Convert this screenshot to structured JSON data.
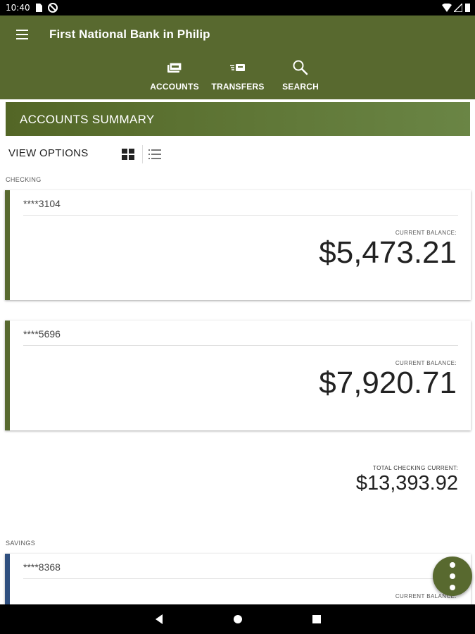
{
  "status_bar": {
    "time": "10:40"
  },
  "app": {
    "title": "First National Bank in Philip",
    "nav": [
      {
        "label": "ACCOUNTS",
        "icon": "accounts-icon"
      },
      {
        "label": "TRANSFERS",
        "icon": "transfers-icon"
      },
      {
        "label": "SEARCH",
        "icon": "search-icon"
      }
    ]
  },
  "summary": {
    "title": "ACCOUNTS SUMMARY"
  },
  "view_options": {
    "label": "VIEW OPTIONS",
    "selected": "grid"
  },
  "checking": {
    "section_label": "CHECKING",
    "accounts": [
      {
        "number": "****3104",
        "balance_label": "CURRENT BALANCE:",
        "balance": "$5,473.21"
      },
      {
        "number": "****5696",
        "balance_label": "CURRENT BALANCE:",
        "balance": "$7,920.71"
      }
    ],
    "total_label": "TOTAL CHECKING CURRENT:",
    "total": "$13,393.92"
  },
  "savings": {
    "section_label": "SAVINGS",
    "accounts": [
      {
        "number": "****8368",
        "balance_label": "CURRENT BALANCE:"
      }
    ]
  },
  "colors": {
    "brand": "#58692f",
    "savings_accent": "#2f4f7f"
  }
}
